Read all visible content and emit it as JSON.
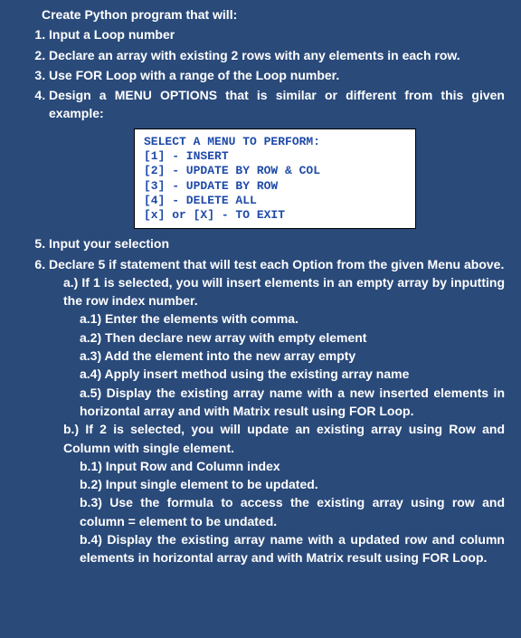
{
  "lead": "Create Python program that will:",
  "items": [
    "Input a Loop number",
    "Declare an array with existing 2 rows with any elements in each row.",
    "Use FOR Loop with a range of the Loop number.",
    "Design a MENU OPTIONS that is similar or different from this given example:"
  ],
  "menu": "SELECT A MENU TO PERFORM:\n[1] - INSERT\n[2] - UPDATE BY ROW & COL\n[3] - UPDATE BY ROW\n[4] - DELETE ALL\n[x] or [X] - TO EXIT",
  "item5": "Input your selection",
  "item6": "Declare 5 if statement that will test each Option from the given Menu above.",
  "a_intro": "a.) If 1 is selected, you will insert elements in an empty array by inputting the row index number.",
  "a": {
    "a1": "a.1)  Enter the elements with comma.",
    "a2": "a.2)  Then declare new array with empty element",
    "a3": "a.3)  Add the element into the new array empty",
    "a4": "a.4)  Apply insert method using the existing array name",
    "a5": "a.5) Display the existing array name with a new inserted elements in horizontal array and with Matrix result using FOR Loop."
  },
  "b_intro": "b.) If 2 is selected, you will update an existing array using Row and Column with single element.",
  "b": {
    "b1": "b.1) Input Row and Column index",
    "b2": "b.2) Input single element to be updated.",
    "b3": "b.3) Use the formula to access the existing array using row and column = element to be undated.",
    "b4": "b.4) Display the existing array name with a updated row and column elements in horizontal array and with Matrix result using FOR Loop."
  }
}
